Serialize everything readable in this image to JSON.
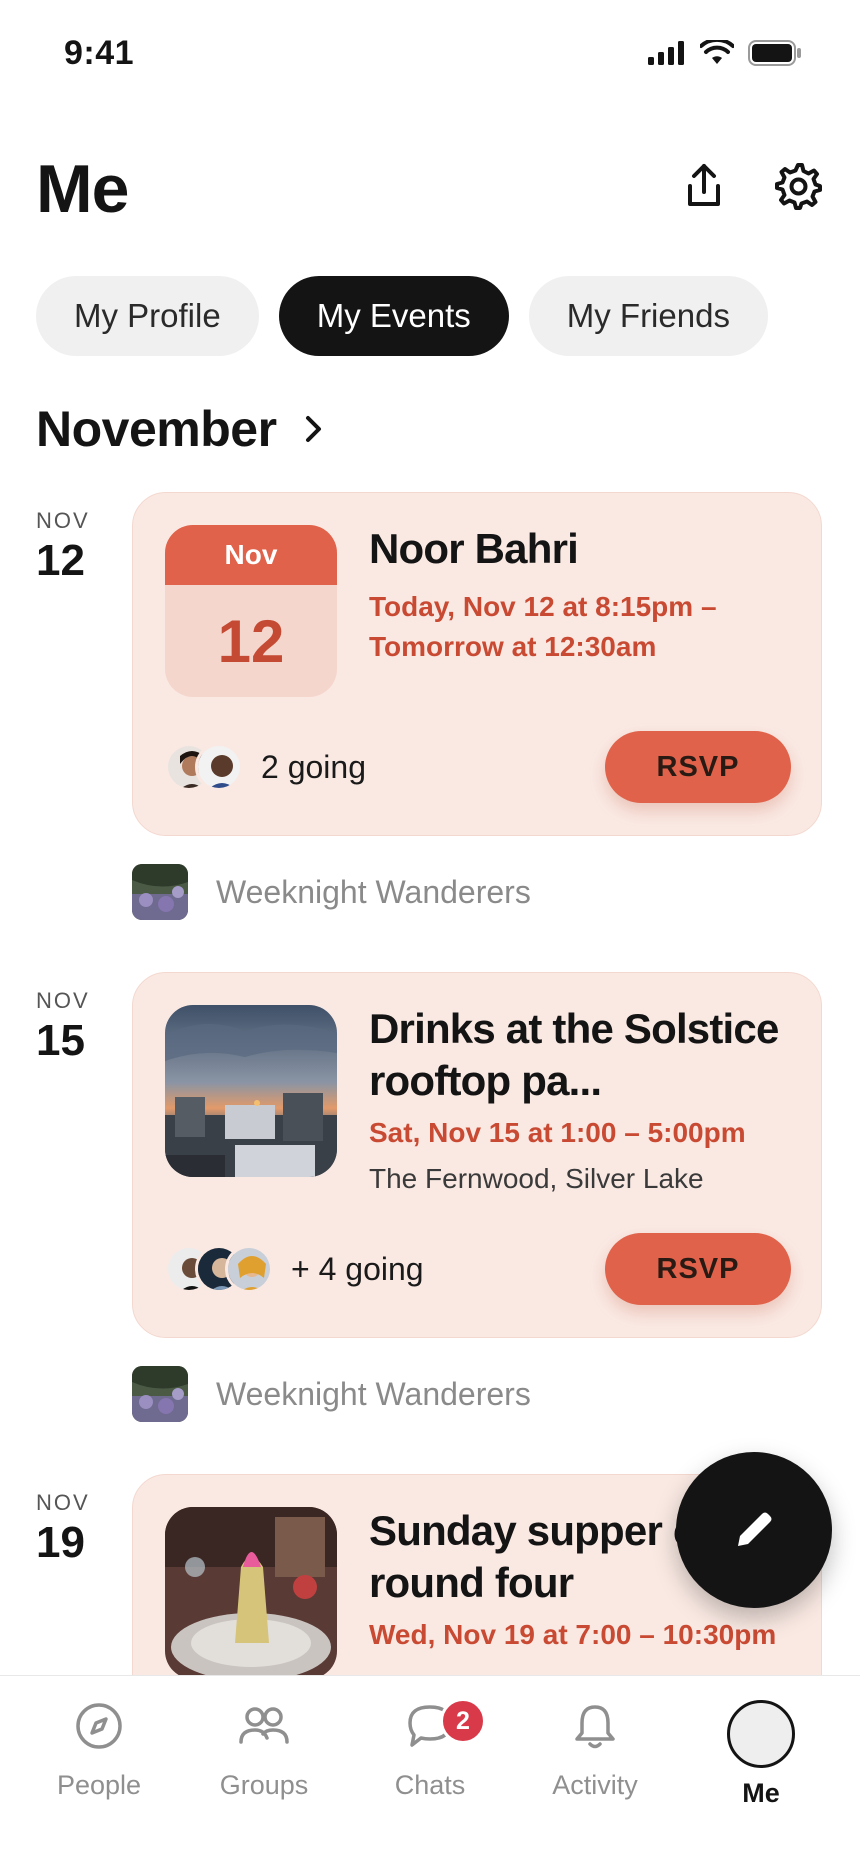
{
  "status": {
    "time": "9:41"
  },
  "header": {
    "title": "Me"
  },
  "tabs": [
    {
      "label": "My Profile",
      "active": false
    },
    {
      "label": "My Events",
      "active": true
    },
    {
      "label": "My Friends",
      "active": false
    }
  ],
  "month": {
    "label": "November"
  },
  "events": [
    {
      "date_month": "NOV",
      "date_day": "12",
      "calendar_month": "Nov",
      "calendar_day": "12",
      "title": "Noor Bahri",
      "when": "Today, Nov 12 at 8:15pm – Tomorrow at 12:30am",
      "where": "",
      "going": "2 going",
      "rsvp": "RSVP",
      "group": "Weeknight Wanderers"
    },
    {
      "date_month": "NOV",
      "date_day": "15",
      "title": "Drinks at the Solstice rooftop pa...",
      "when": "Sat, Nov 15 at 1:00 – 5:00pm",
      "where": "The Fernwood, Silver Lake",
      "going": "+ 4 going",
      "rsvp": "RSVP",
      "group": "Weeknight Wanderers"
    },
    {
      "date_month": "NOV",
      "date_day": "19",
      "title": "Sunday supper club round four",
      "when": "Wed, Nov 19 at 7:00 – 10:30pm",
      "where": ""
    }
  ],
  "tabbar": [
    {
      "label": "People",
      "icon": "compass-icon"
    },
    {
      "label": "Groups",
      "icon": "groups-icon"
    },
    {
      "label": "Chats",
      "icon": "chat-bubble-icon",
      "badge": "2"
    },
    {
      "label": "Activity",
      "icon": "bell-icon"
    },
    {
      "label": "Me",
      "icon": "avatar",
      "active": true
    }
  ],
  "colors": {
    "accent": "#e0624a",
    "card_bg": "#fae9e3",
    "accent_text": "#c94a33",
    "badge": "#d93a4a",
    "dark": "#141414"
  }
}
